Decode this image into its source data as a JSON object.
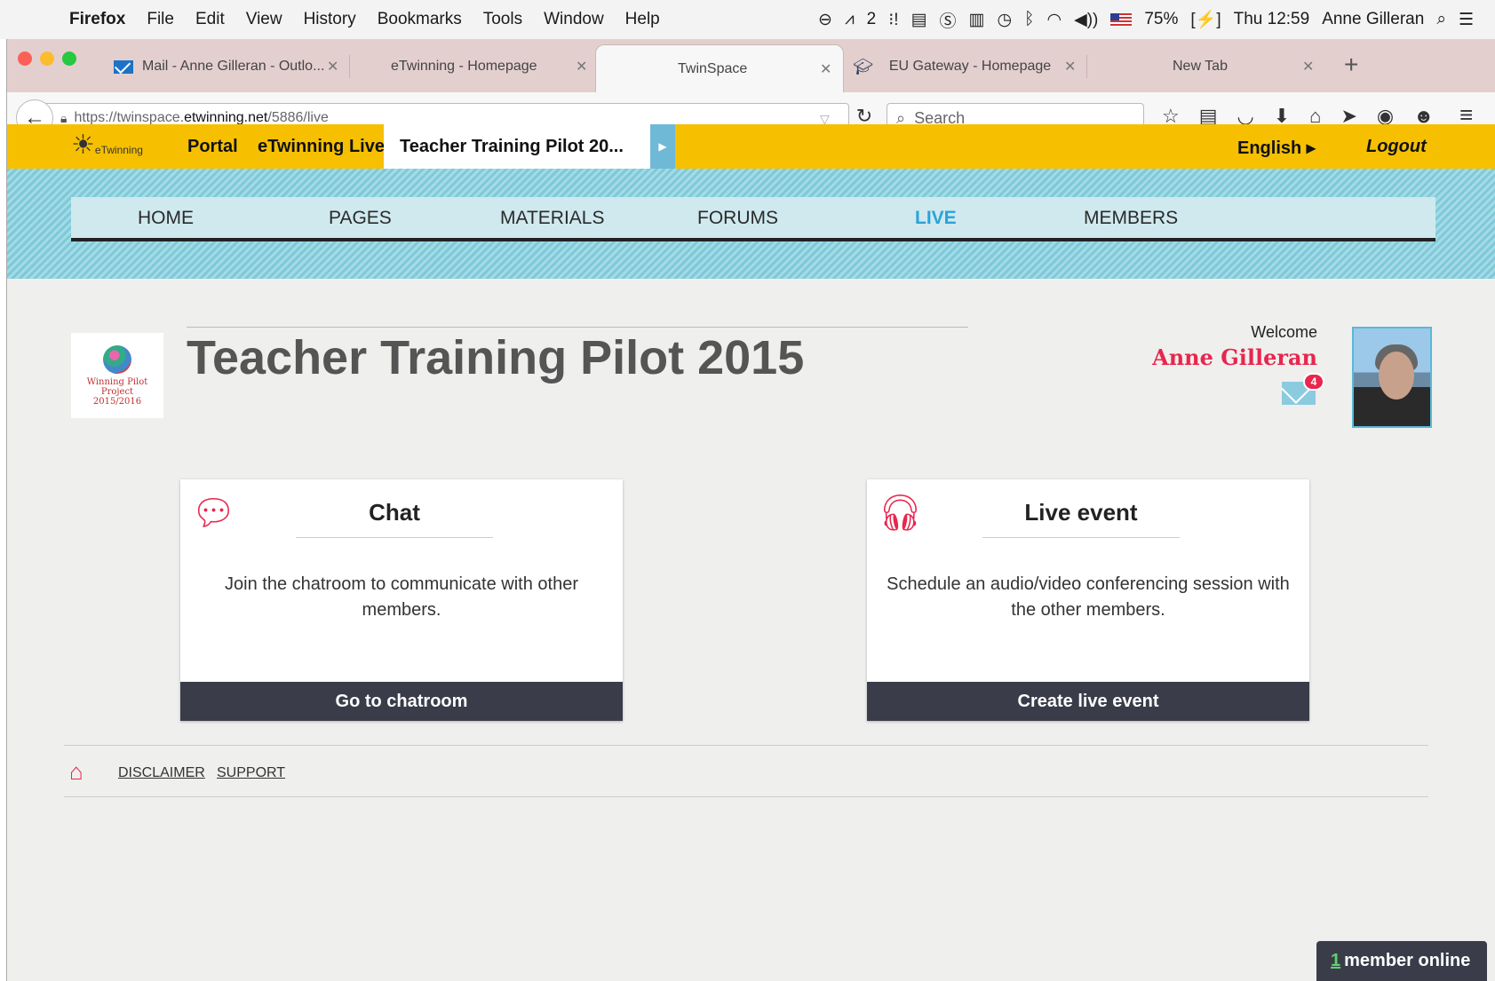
{
  "menubar": {
    "apple": "",
    "items": [
      "Firefox",
      "File",
      "Edit",
      "View",
      "History",
      "Bookmarks",
      "Tools",
      "Window",
      "Help"
    ],
    "adobe_badge": "2",
    "battery": "75%",
    "clock": "Thu 12:59",
    "user": "Anne Gilleran"
  },
  "tabs": [
    {
      "label": "Mail - Anne Gilleran - Outlo...",
      "icon": "mail-icon",
      "close": "✕"
    },
    {
      "label": "eTwinning - Homepage",
      "close": "✕"
    },
    {
      "label": "TwinSpace",
      "close": "✕",
      "active": true
    },
    {
      "label": "EU Gateway - Homepage",
      "icon": "graduation-cap-icon",
      "close": "✕"
    },
    {
      "label": "New Tab",
      "close": "✕"
    }
  ],
  "newtab": "+",
  "navbar": {
    "url_prefix": "https://twinspace.",
    "url_domain": "etwinning.net",
    "url_path": "/5886/live",
    "search_placeholder": "Search"
  },
  "etwinning": {
    "logo_text": "eTwinning",
    "portal": "Portal",
    "live": "eTwinning Live",
    "current_tab": "Teacher Training Pilot 20...",
    "language": "English ▸",
    "logout": "Logout"
  },
  "ts_nav": [
    "HOME",
    "PAGES",
    "MATERIALS",
    "FORUMS",
    "LIVE",
    "MEMBERS"
  ],
  "ts_nav_active": "LIVE",
  "project": {
    "logo_text_1": "Winning Pilot Project",
    "logo_text_2": "2015/2016",
    "title": "Teacher Training Pilot 2015"
  },
  "user": {
    "welcome": "Welcome",
    "name": "Anne Gilleran",
    "messages": "4"
  },
  "cards": [
    {
      "title": "Chat",
      "description": "Join the chatroom to communicate with other members.",
      "button": "Go to chatroom",
      "icon": "chat-bubble-icon"
    },
    {
      "title": "Live event",
      "description": "Schedule an audio/video conferencing session with the other members.",
      "button": "Create live event",
      "icon": "headphones-icon"
    }
  ],
  "footer": {
    "disclaimer": "DISCLAIMER",
    "support": "SUPPORT"
  },
  "online": {
    "count": "1",
    "label": "member online"
  },
  "colors": {
    "accent_red": "#e8264e",
    "etwinning_yellow": "#f6c000",
    "nav_active": "#2ba3d8",
    "button_dark": "#3a3c4a"
  }
}
